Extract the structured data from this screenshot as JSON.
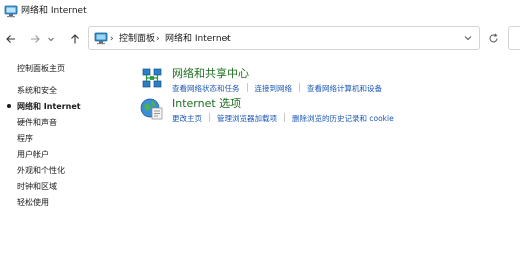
{
  "window": {
    "title": "网络和 Internet"
  },
  "addressbar": {
    "crumbs": [
      "控制面板",
      "网络和 Internet"
    ]
  },
  "sidebar": {
    "items": [
      {
        "label": "控制面板主页",
        "active": false
      },
      {
        "label": "系统和安全",
        "active": false
      },
      {
        "label": "网络和 Internet",
        "active": true
      },
      {
        "label": "硬件和声音",
        "active": false
      },
      {
        "label": "程序",
        "active": false
      },
      {
        "label": "用户帐户",
        "active": false
      },
      {
        "label": "外观和个性化",
        "active": false
      },
      {
        "label": "时钟和区域",
        "active": false
      },
      {
        "label": "轻松使用",
        "active": false
      }
    ]
  },
  "categories": [
    {
      "title": "网络和共享中心",
      "icon": "network-sharing-icon",
      "links": [
        "查看网络状态和任务",
        "连接到网络",
        "查看网络计算机和设备"
      ]
    },
    {
      "title": "Internet 选项",
      "icon": "internet-options-icon",
      "links": [
        "更改主页",
        "管理浏览器加载项",
        "删除浏览的历史记录和 cookie"
      ]
    }
  ],
  "colors": {
    "title_green": "#1e6e1e",
    "link_blue": "#1b56b5"
  }
}
